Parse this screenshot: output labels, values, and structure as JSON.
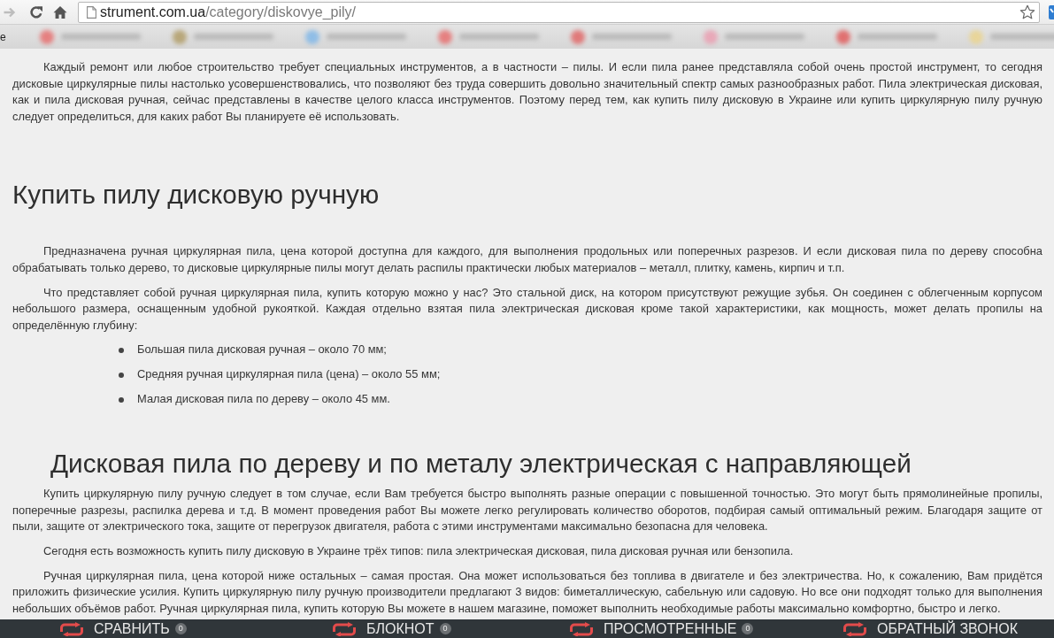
{
  "browser": {
    "forward_button": {
      "disabled": true
    },
    "url_domain": "strument.com.ua",
    "url_path": "/category/diskovye_pily/"
  },
  "bookmarks_bar": {
    "cut_text": "e"
  },
  "article": {
    "intro": "Каждый ремонт или любое строительство требует специальных инструментов, а в частности – пилы. И если пила ранее представляла собой очень простой инструмент, то сегодня дисковые циркулярные пилы настолько усовершенствовались, что позволяют без труда совершить довольно значительный спектр самых разнообразных работ.  Пила электрическая дисковая, как и пила дисковая ручная, сейчас представлены в качестве целого класса инструментов. Поэтому перед тем, как купить пилу дисковую в Украине или купить циркулярную пилу ручную следует определиться, для каких работ Вы планируете её использовать.",
    "sections": [
      {
        "heading": "Купить пилу дисковую ручную",
        "paragraphs": [
          "Предназначена ручная циркулярная пила, цена которой доступна для каждого, для выполнения продольных или поперечных разрезов. И если дисковая пила по дереву способна обрабатывать только дерево, то дисковые циркулярные пилы могут делать распилы практически любых материалов – металл, плитку, камень, кирпич и т.п.",
          "Что представляет собой ручная циркулярная пила, купить которую можно у нас? Это стальной диск, на котором присутствуют режущие зубья. Он соединен с облегченным корпусом небольшого размера, оснащенным удобной рукояткой. Каждая отдельно взятая пила электрическая дисковая кроме такой характеристики, как мощность, может делать пропилы на определённую глубину:"
        ],
        "list": [
          "Большая пила дисковая ручная – около 70 мм;",
          "Средняя ручная циркулярная пила (цена) – около 55 мм;",
          "Малая дисковая пила по дереву – около 45 мм."
        ]
      },
      {
        "heading": "Дисковая пила по дереву и по металу электрическая с направляющей",
        "paragraphs": [
          "Купить циркулярную пилу ручную следует в том случае, если Вам требуется быстро выполнять разные операции с повышенной точностью. Это могут быть прямолинейные пропилы, поперечные разрезы, распилка дерева и т.д. В момент проведения работ Вы можете легко регулировать количество оборотов, подбирая самый оптимальный режим. Благодаря защите от пыли, защите от электрического тока, защите от перегрузок двигателя, работа с этими инструментами максимально безопасна для человека.",
          "Сегодня есть возможность купить пилу дисковую в Украине трёх типов: пила электрическая дисковая, пила дисковая ручная или бензопила.",
          "Ручная циркулярная пила, цена которой ниже остальных – самая простая. Она может использоваться без топлива в двигателе и без электричества. Но, к сожалению, Вам придётся приложить физические усилия. Купить циркулярную пилу ручную производители предлагают 3 видов: биметаллическую, сабельную или садовую. Но все они подходят только для выполнения небольших объёмов работ. Ручная циркулярная пила, купить которую Вы можете в нашем магазине, поможет выполнить необходимые работы максимально комфортно, быстро и легко."
        ]
      }
    ]
  },
  "bottom_bar": {
    "items": [
      {
        "label": "СРАВНИТЬ",
        "count": "0"
      },
      {
        "label": "БЛОКНОТ",
        "count": "0"
      },
      {
        "label": "ПРОСМОТРЕННЫЕ",
        "count": "0"
      },
      {
        "label": "ОБРАТНЫЙ ЗВОНОК"
      }
    ]
  }
}
